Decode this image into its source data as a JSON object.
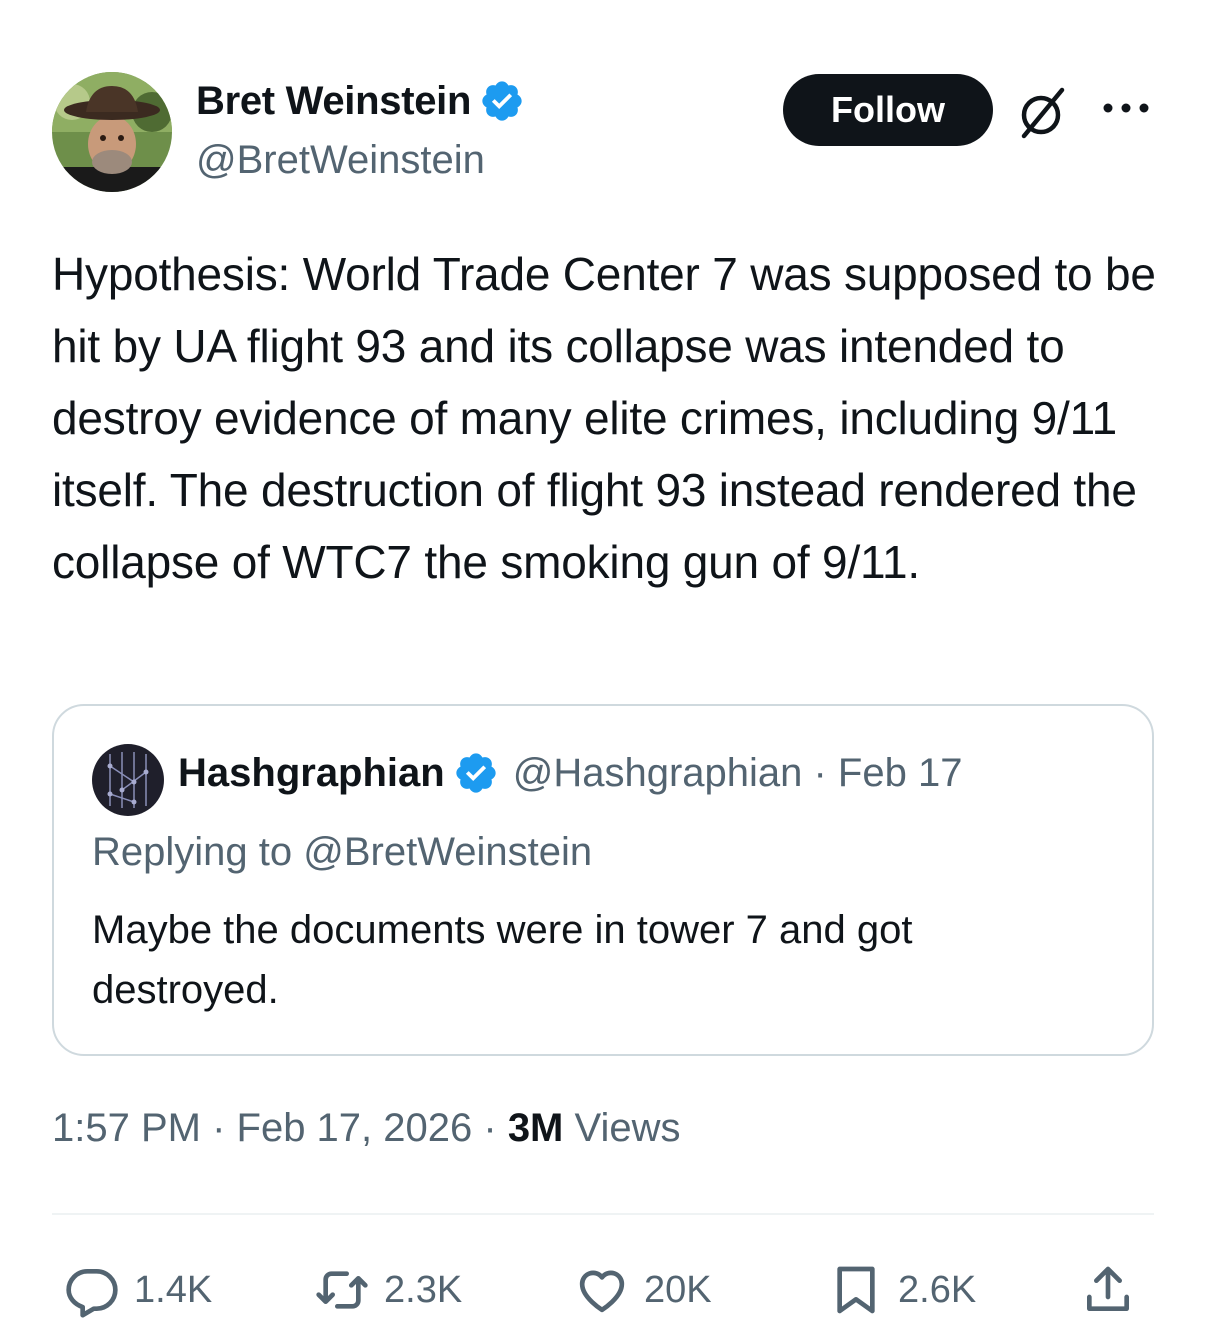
{
  "author": {
    "name": "Bret Weinstein",
    "handle": "@BretWeinstein",
    "avatar_icon": "avatar-photo"
  },
  "toolbar": {
    "follow_label": "Follow",
    "grok_icon": "grok-icon",
    "more_icon": "more-icon"
  },
  "tweet": {
    "text": "Hypothesis: World Trade Center 7 was supposed to be hit by UA flight 93 and its collapse was intended to destroy evidence of many elite crimes, including 9/11 itself. The destruction of flight 93 instead rendered the collapse of WTC7 the smoking gun of 9/11."
  },
  "quote": {
    "name": "Hashgraphian",
    "meta": "@Hashgraphian · Feb 17",
    "replying": "Replying to @BretWeinstein",
    "text": "Maybe the documents were in tower 7 and got destroyed."
  },
  "meta": {
    "timestamp": "1:57 PM · Feb 17, 2026 · ",
    "views_count": "3M",
    "views_label": " Views"
  },
  "actions": {
    "replies": "1.4K",
    "reposts": "2.3K",
    "likes": "20K",
    "bookmarks": "2.6K"
  },
  "colors": {
    "verified": "#1d9bf0",
    "text": "#0f1419",
    "secondary": "#536471",
    "border": "#cfd9de"
  }
}
